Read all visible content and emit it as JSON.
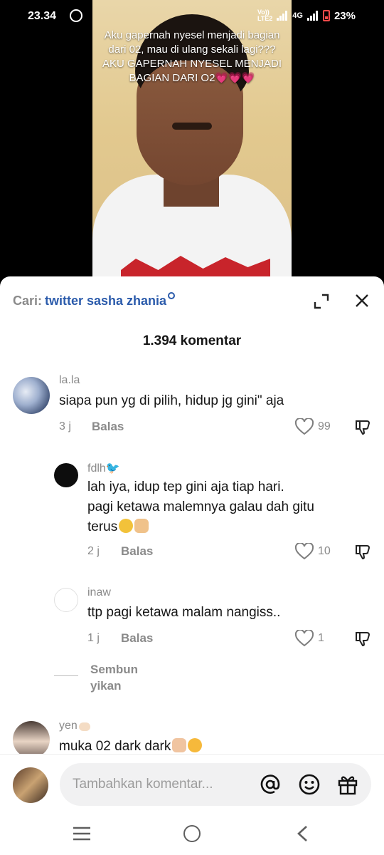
{
  "status_bar": {
    "time": "23.34",
    "volte": "Vo))",
    "lte": "LTE2",
    "net_type": "4G",
    "battery": "23%"
  },
  "video": {
    "caption": "Aku gapernah nyesel menjadi bagian dari 02, mau di ulang sekali lagi??? AKU GAPERNAH NYESEL MENJADI BAGIAN DARI O2💗💗💗"
  },
  "sheet": {
    "search_label": "Cari:",
    "search_query": "twitter sasha zhania",
    "comment_count": "1.394 komentar"
  },
  "comments": [
    {
      "user": "la.la",
      "text": "siapa pun yg di pilih, hidup jg gini\" aja",
      "time": "3 j",
      "reply": "Balas",
      "likes": "99"
    },
    {
      "user": "fdlh🐦",
      "line1": "lah iya, idup tep gini aja tiap hari.",
      "line2": "pagi ketawa malemnya galau dah gitu",
      "line3": "terus",
      "time": "2 j",
      "reply": "Balas",
      "likes": "10"
    },
    {
      "user": "inaw",
      "text": "ttp pagi ketawa malam nangiss..",
      "time": "1 j",
      "reply": "Balas",
      "likes": "1"
    },
    {
      "user": "yen",
      "text": "muka 02 dark dark"
    }
  ],
  "more_replies": {
    "line1": "Sembun",
    "line2": "yikan"
  },
  "input": {
    "placeholder": "Tambahkan komentar..."
  },
  "colors": {
    "link_blue": "#2b5bab",
    "muted": "#8a8a8a",
    "text": "#161616"
  },
  "icons": [
    "whatsapp-icon",
    "search-icon",
    "expand-icon",
    "close-icon",
    "heart-icon",
    "dislike-icon",
    "at-icon",
    "emoji-icon",
    "gift-icon",
    "recents-icon",
    "home-icon",
    "back-icon"
  ]
}
